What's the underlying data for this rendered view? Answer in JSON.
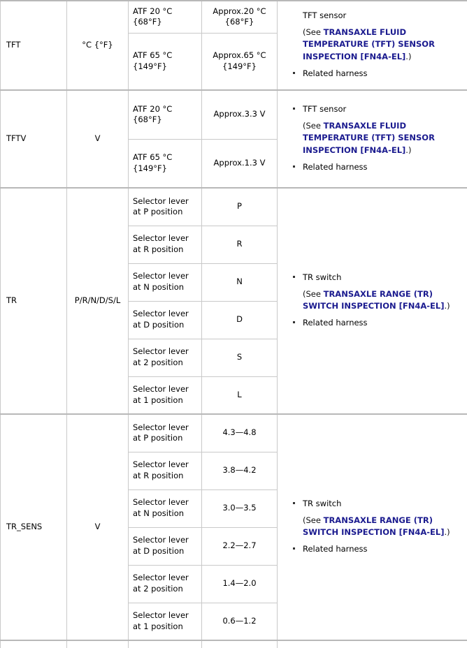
{
  "table": {
    "colors": {
      "link": "#1b1b8f",
      "border": "#c9c9c9",
      "group_border": "#b8b8b8",
      "text": "#000000"
    },
    "rows": [
      {
        "pid": "TFT",
        "unit": "°C {°F}",
        "conditions": [
          {
            "condition": "ATF 20 °C {68°F}",
            "specification": "Approx.20 °C {68°F}"
          },
          {
            "condition": "ATF 65 °C {149°F}",
            "specification": "Approx.65 °C {149°F}"
          }
        ],
        "action": {
          "items": [
            {
              "text": "TFT sensor",
              "bullet": false
            },
            {
              "text": "Related harness",
              "bullet": true
            }
          ],
          "note": {
            "prefix": "(See ",
            "link": "TRANSAXLE FLUID TEMPERATURE (TFT) SENSOR INSPECTION [FN4A-EL]",
            "suffix": ".)"
          }
        }
      },
      {
        "pid": "TFTV",
        "unit": "V",
        "conditions": [
          {
            "condition": "ATF 20 °C {68°F}",
            "specification": "Approx.3.3 V"
          },
          {
            "condition": "ATF 65 °C {149°F}",
            "specification": "Approx.1.3 V"
          }
        ],
        "action": {
          "items": [
            {
              "text": "TFT sensor",
              "bullet": true
            },
            {
              "text": "Related harness",
              "bullet": true
            }
          ],
          "note": {
            "prefix": "(See ",
            "link": "TRANSAXLE FLUID TEMPERATURE (TFT) SENSOR INSPECTION [FN4A-EL]",
            "suffix": ".)"
          }
        }
      },
      {
        "pid": "TR",
        "unit": "P/R/N/D/S/L",
        "conditions": [
          {
            "condition": "Selector lever at P position",
            "specification": "P"
          },
          {
            "condition": "Selector lever at R position",
            "specification": "R"
          },
          {
            "condition": "Selector lever at N position",
            "specification": "N"
          },
          {
            "condition": "Selector lever at D position",
            "specification": "D"
          },
          {
            "condition": "Selector lever at 2 position",
            "specification": "S"
          },
          {
            "condition": "Selector lever at 1 position",
            "specification": "L"
          }
        ],
        "action": {
          "items": [
            {
              "text": "TR switch",
              "bullet": true
            },
            {
              "text": "Related harness",
              "bullet": true
            }
          ],
          "note": {
            "prefix": "(See ",
            "link": "TRANSAXLE RANGE (TR) SWITCH INSPECTION [FN4A-EL]",
            "suffix": ".)"
          }
        }
      },
      {
        "pid": "TR_SENS",
        "unit": "V",
        "conditions": [
          {
            "condition": "Selector lever at P position",
            "specification": "4.3—4.8"
          },
          {
            "condition": "Selector lever at R position",
            "specification": "3.8—4.2"
          },
          {
            "condition": "Selector lever at N position",
            "specification": "3.0—3.5"
          },
          {
            "condition": "Selector lever at D position",
            "specification": "2.2—2.7"
          },
          {
            "condition": "Selector lever at 2 position",
            "specification": "1.4—2.0"
          },
          {
            "condition": "Selector lever at 1 position",
            "specification": "0.6—1.2"
          }
        ],
        "action": {
          "items": [
            {
              "text": "TR switch",
              "bullet": true
            },
            {
              "text": "Related harness",
              "bullet": true
            }
          ],
          "note": {
            "prefix": "(See ",
            "link": "TRANSAXLE RANGE (TR) SWITCH INSPECTION [FN4A-EL]",
            "suffix": ".)"
          }
        }
      },
      {
        "pid": "",
        "unit": "",
        "conditions": [
          {
            "condition": "",
            "specification": ""
          }
        ],
        "action": {
          "items": [],
          "note": null
        }
      }
    ]
  }
}
